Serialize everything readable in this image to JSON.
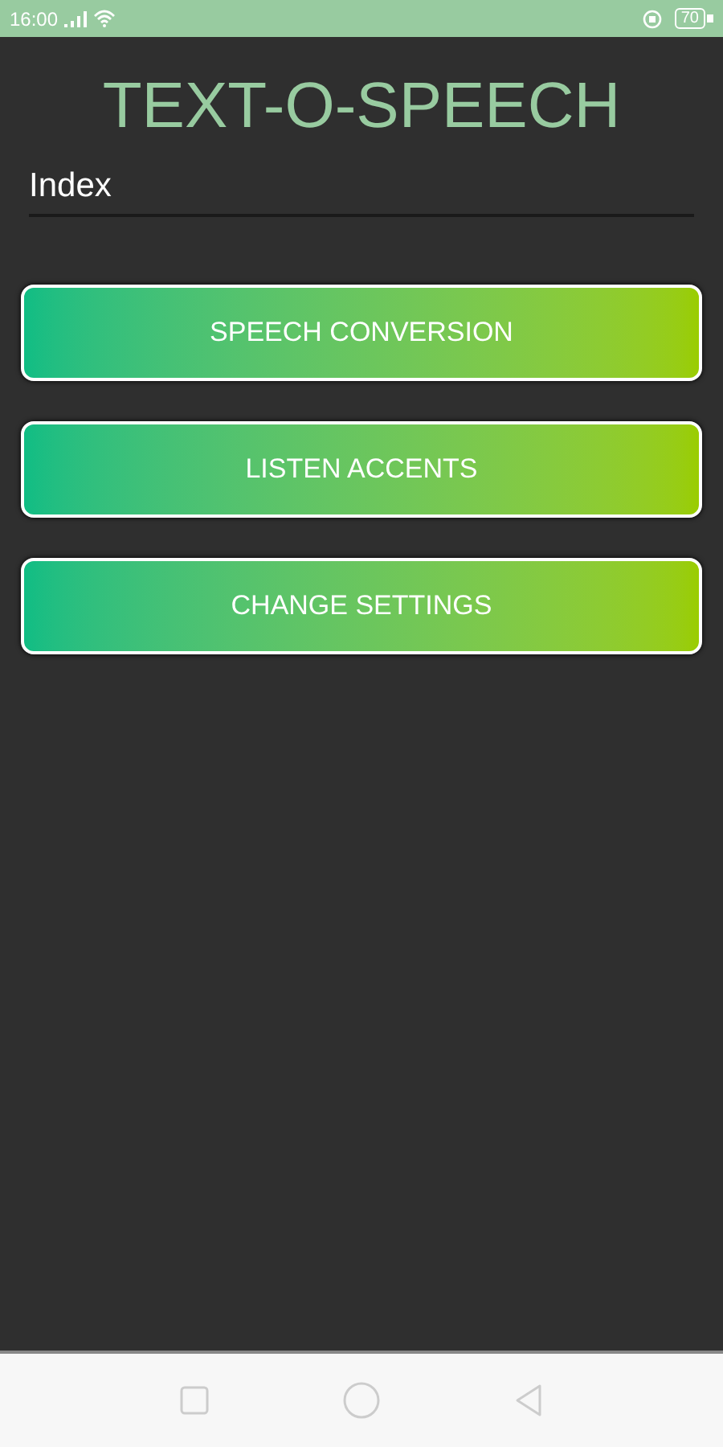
{
  "status_bar": {
    "time": "16:00",
    "battery": "70"
  },
  "title": "TEXT-O-SPEECH",
  "field": {
    "value": "Index"
  },
  "buttons": [
    {
      "label": "SPEECH CONVERSION"
    },
    {
      "label": "LISTEN ACCENTS"
    },
    {
      "label": "CHANGE SETTINGS"
    }
  ]
}
